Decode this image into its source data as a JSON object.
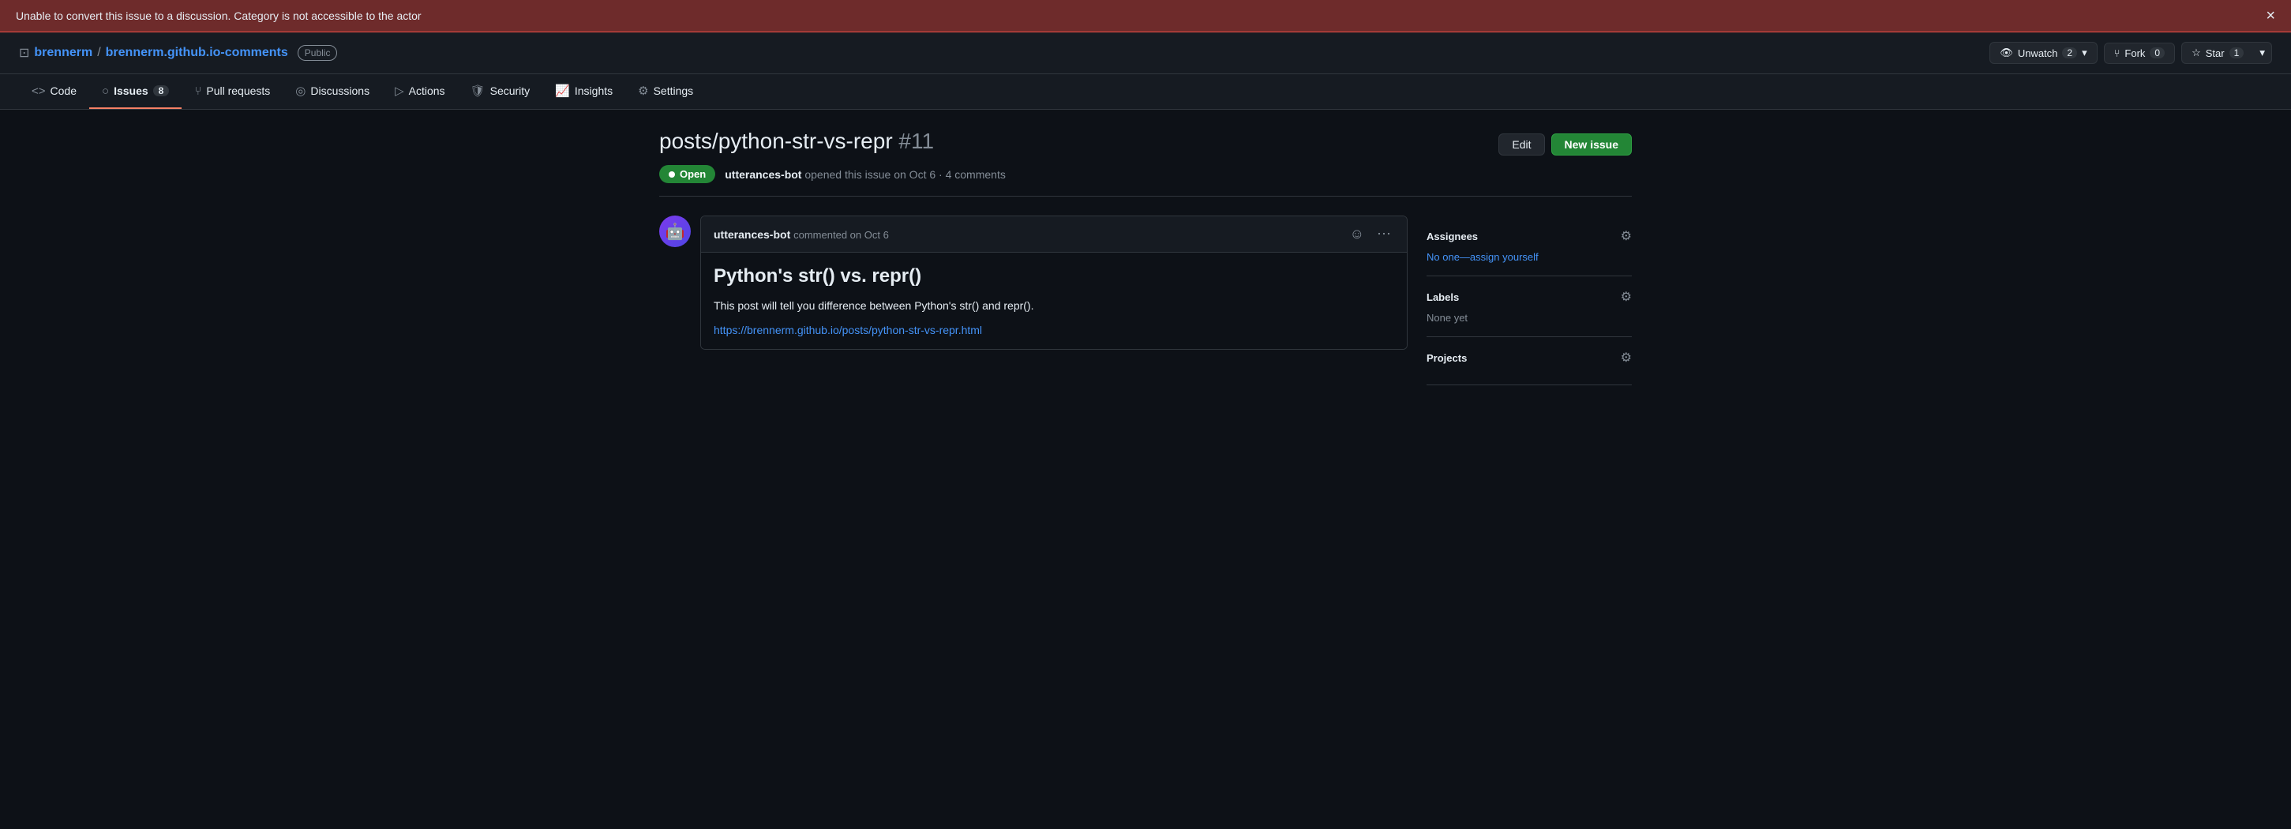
{
  "error_banner": {
    "message": "Unable to convert this issue to a discussion. Category is not accessible to the actor",
    "close_label": "×"
  },
  "repo_header": {
    "icon": "⊡",
    "owner": "brennerm",
    "separator": "/",
    "name": "brennerm.github.io-comments",
    "visibility": "Public",
    "unwatch_label": "Unwatch",
    "unwatch_count": "2",
    "fork_label": "Fork",
    "fork_count": "0",
    "star_label": "Star",
    "star_count": "1"
  },
  "nav": {
    "tabs": [
      {
        "id": "code",
        "label": "Code",
        "icon": "<>",
        "active": false
      },
      {
        "id": "issues",
        "label": "Issues",
        "icon": "○",
        "count": "8",
        "active": true
      },
      {
        "id": "pull-requests",
        "label": "Pull requests",
        "icon": "⑂",
        "active": false
      },
      {
        "id": "discussions",
        "label": "Discussions",
        "icon": "◎",
        "active": false
      },
      {
        "id": "actions",
        "label": "Actions",
        "icon": "▷",
        "active": false
      },
      {
        "id": "security",
        "label": "Security",
        "icon": "🛡",
        "active": false
      },
      {
        "id": "insights",
        "label": "Insights",
        "icon": "📈",
        "active": false
      },
      {
        "id": "settings",
        "label": "Settings",
        "icon": "⚙",
        "active": false
      }
    ]
  },
  "issue": {
    "title": "posts/python-str-vs-repr",
    "number": "#11",
    "status": "Open",
    "author": "utterances-bot",
    "opened_text": "opened this issue on Oct 6",
    "comments_count": "4 comments",
    "edit_label": "Edit",
    "new_issue_label": "New issue"
  },
  "comment": {
    "author": "utterances-bot",
    "action": "commented",
    "time": "on Oct 6",
    "title": "Python's str() vs. repr()",
    "body": "This post will tell you difference between Python's str() and repr().",
    "link": "https://brennerm.github.io/posts/python-str-vs-repr.html",
    "emoji_btn": "☺",
    "more_btn": "⋯"
  },
  "sidebar": {
    "assignees": {
      "title": "Assignees",
      "value": "No one—assign yourself"
    },
    "labels": {
      "title": "Labels",
      "value": "None yet"
    },
    "projects": {
      "title": "Projects"
    }
  }
}
